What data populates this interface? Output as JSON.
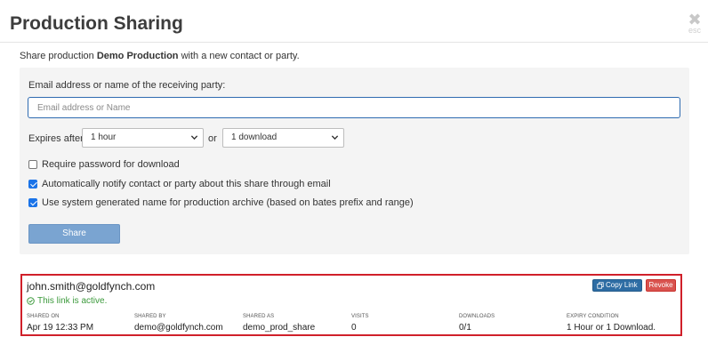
{
  "modal": {
    "title": "Production Sharing",
    "close_glyph": "✖",
    "close_hint": "esc"
  },
  "intro": {
    "prefix": "Share production",
    "production_name": "Demo Production",
    "suffix": "with a new contact or party."
  },
  "form": {
    "email_label": "Email address or name of the receiving party:",
    "email_value": "",
    "email_placeholder": "Email address or Name",
    "expires_label": "Expires after",
    "expires_time_selected": "1 hour",
    "or_label": "or",
    "expires_downloads_selected": "1 download",
    "checkboxes": [
      {
        "label": "Require password for download",
        "checked": false
      },
      {
        "label": "Automatically notify contact or party about this share through email",
        "checked": true
      },
      {
        "label": "Use system generated name for production archive (based on bates prefix and range)",
        "checked": true
      }
    ],
    "share_button": "Share"
  },
  "share": {
    "email": "john.smith@goldfynch.com",
    "status": "This link is active.",
    "copy_link_button": "Copy Link",
    "revoke_button": "Revoke",
    "columns": [
      {
        "header": "SHARED ON",
        "value": "Apr 19 12:33 PM"
      },
      {
        "header": "SHARED BY",
        "value": "demo@goldfynch.com"
      },
      {
        "header": "SHARED AS",
        "value": "demo_prod_share"
      },
      {
        "header": "VISITS",
        "value": "0"
      },
      {
        "header": "DOWNLOADS",
        "value": "0/1"
      },
      {
        "header": "EXPIRY CONDITION",
        "value": "1 Hour or 1 Download."
      }
    ]
  },
  "colors": {
    "primary": "#2e6da4",
    "share_button": "#7aa4d1",
    "danger": "#d9534f",
    "highlight_border": "#d0202a",
    "success": "#3c9a3c",
    "checkbox_checked": "#1a73e8"
  },
  "icons": {
    "close": "close-icon",
    "status": "check-circle-icon",
    "copy": "copy-icon",
    "dropdown": "chevron-down-icon"
  }
}
